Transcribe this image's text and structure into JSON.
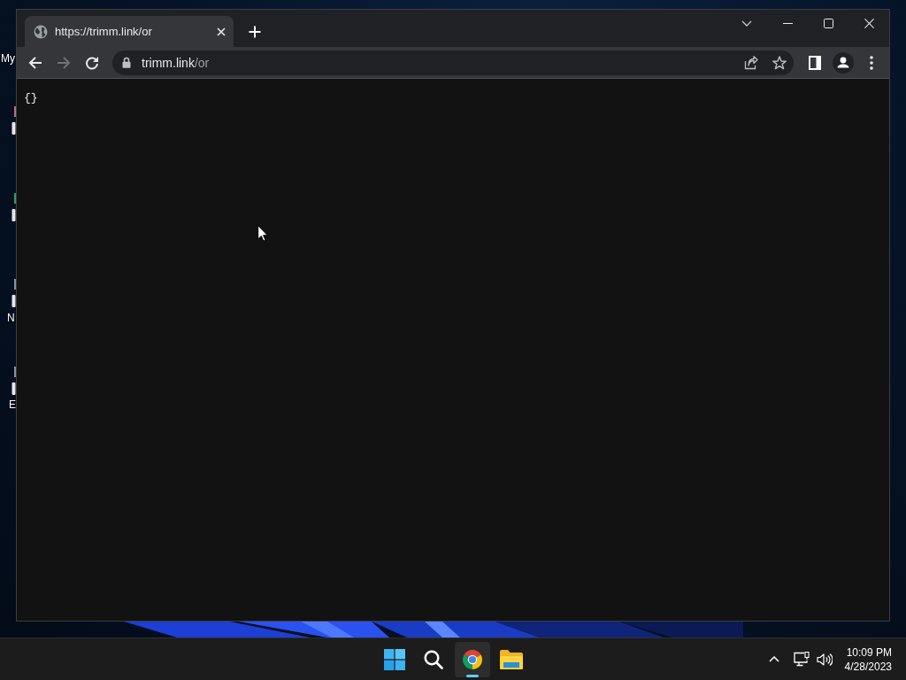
{
  "desktop": {
    "icon_labels": [
      "My",
      "N",
      "E"
    ]
  },
  "browser": {
    "tabs": [
      {
        "title": "https://trimm.link/or",
        "selected": true
      }
    ],
    "nav_buttons": [
      {
        "kind": "back",
        "disabled": false
      },
      {
        "kind": "forward",
        "disabled": true
      },
      {
        "kind": "reload",
        "disabled": false
      }
    ],
    "address_bar": {
      "host": "trimm.link",
      "path": "/or"
    },
    "page": {
      "text": "{}"
    }
  },
  "taskbar": {
    "apps": [
      {
        "kind": "start",
        "active": false
      },
      {
        "kind": "search",
        "active": false
      },
      {
        "kind": "browser",
        "active": true
      },
      {
        "kind": "files",
        "active": false
      }
    ],
    "clock": {
      "time": "10:09 PM",
      "date": "4/28/2023"
    }
  }
}
